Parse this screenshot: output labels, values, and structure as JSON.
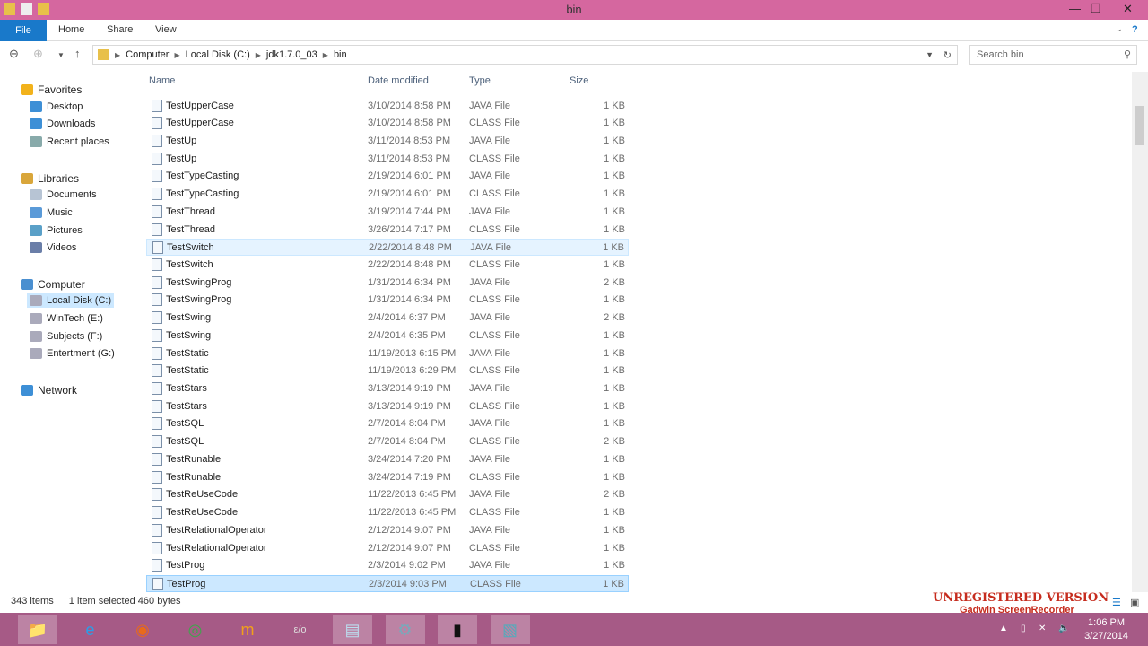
{
  "window": {
    "title": "bin"
  },
  "ribbon": {
    "file": "File",
    "tabs": [
      "Home",
      "Share",
      "View"
    ]
  },
  "breadcrumb": [
    "Computer",
    "Local Disk (C:)",
    "jdk1.7.0_03",
    "bin"
  ],
  "search": {
    "placeholder": "Search bin"
  },
  "sidebar": [
    {
      "label": "Favorites",
      "icon": "star-icon",
      "group": true
    },
    {
      "label": "Desktop",
      "icon": "desktop-icon"
    },
    {
      "label": "Downloads",
      "icon": "downloads-icon"
    },
    {
      "label": "Recent places",
      "icon": "recent-places-icon"
    },
    {
      "label": "Libraries",
      "icon": "libraries-icon",
      "group": true
    },
    {
      "label": "Documents",
      "icon": "documents-icon"
    },
    {
      "label": "Music",
      "icon": "music-icon"
    },
    {
      "label": "Pictures",
      "icon": "pictures-icon"
    },
    {
      "label": "Videos",
      "icon": "videos-icon"
    },
    {
      "label": "Computer",
      "icon": "computer-icon",
      "group": true
    },
    {
      "label": "Local Disk (C:)",
      "icon": "drive-icon",
      "selected": true
    },
    {
      "label": "WinTech (E:)",
      "icon": "drive-icon"
    },
    {
      "label": "Subjects (F:)",
      "icon": "drive-icon"
    },
    {
      "label": "Entertment (G:)",
      "icon": "drive-icon"
    },
    {
      "label": "Network",
      "icon": "network-icon",
      "group": true
    }
  ],
  "columns": [
    "Name",
    "Date modified",
    "Type",
    "Size"
  ],
  "files": [
    [
      "TestUpperCase",
      "3/10/2014 8:58 PM",
      "JAVA File",
      "1 KB"
    ],
    [
      "TestUpperCase",
      "3/10/2014 8:58 PM",
      "CLASS File",
      "1 KB"
    ],
    [
      "TestUp",
      "3/11/2014 8:53 PM",
      "JAVA File",
      "1 KB"
    ],
    [
      "TestUp",
      "3/11/2014 8:53 PM",
      "CLASS File",
      "1 KB"
    ],
    [
      "TestTypeCasting",
      "2/19/2014 6:01 PM",
      "JAVA File",
      "1 KB"
    ],
    [
      "TestTypeCasting",
      "2/19/2014 6:01 PM",
      "CLASS File",
      "1 KB"
    ],
    [
      "TestThread",
      "3/19/2014 7:44 PM",
      "JAVA File",
      "1 KB"
    ],
    [
      "TestThread",
      "3/26/2014 7:17 PM",
      "CLASS File",
      "1 KB"
    ],
    [
      "TestSwitch",
      "2/22/2014 8:48 PM",
      "JAVA File",
      "1 KB"
    ],
    [
      "TestSwitch",
      "2/22/2014 8:48 PM",
      "CLASS File",
      "1 KB"
    ],
    [
      "TestSwingProg",
      "1/31/2014 6:34 PM",
      "JAVA File",
      "2 KB"
    ],
    [
      "TestSwingProg",
      "1/31/2014 6:34 PM",
      "CLASS File",
      "1 KB"
    ],
    [
      "TestSwing",
      "2/4/2014 6:37 PM",
      "JAVA File",
      "2 KB"
    ],
    [
      "TestSwing",
      "2/4/2014 6:35 PM",
      "CLASS File",
      "1 KB"
    ],
    [
      "TestStatic",
      "11/19/2013 6:15 PM",
      "JAVA File",
      "1 KB"
    ],
    [
      "TestStatic",
      "11/19/2013 6:29 PM",
      "CLASS File",
      "1 KB"
    ],
    [
      "TestStars",
      "3/13/2014 9:19 PM",
      "JAVA File",
      "1 KB"
    ],
    [
      "TestStars",
      "3/13/2014 9:19 PM",
      "CLASS File",
      "1 KB"
    ],
    [
      "TestSQL",
      "2/7/2014 8:04 PM",
      "JAVA File",
      "1 KB"
    ],
    [
      "TestSQL",
      "2/7/2014 8:04 PM",
      "CLASS File",
      "2 KB"
    ],
    [
      "TestRunable",
      "3/24/2014 7:20 PM",
      "JAVA File",
      "1 KB"
    ],
    [
      "TestRunable",
      "3/24/2014 7:19 PM",
      "CLASS File",
      "1 KB"
    ],
    [
      "TestReUseCode",
      "11/22/2013 6:45 PM",
      "JAVA File",
      "2 KB"
    ],
    [
      "TestReUseCode",
      "11/22/2013 6:45 PM",
      "CLASS File",
      "1 KB"
    ],
    [
      "TestRelationalOperator",
      "2/12/2014 9:07 PM",
      "JAVA File",
      "1 KB"
    ],
    [
      "TestRelationalOperator",
      "2/12/2014 9:07 PM",
      "CLASS File",
      "1 KB"
    ],
    [
      "TestProg",
      "2/3/2014 9:02 PM",
      "JAVA File",
      "1 KB"
    ],
    [
      "TestProg",
      "2/3/2014 9:03 PM",
      "CLASS File",
      "1 KB"
    ]
  ],
  "hovered_index": 8,
  "selected_index": 27,
  "status": {
    "items": "343 items",
    "selection": "1 item selected  460 bytes"
  },
  "watermark": {
    "line1": "UNREGISTERED VERSION",
    "line2": "Gadwin ScreenRecorder"
  },
  "clock": {
    "time": "1:06 PM",
    "date": "3/27/2014"
  },
  "taskbar": [
    "file-explorer-icon",
    "internet-explorer-icon",
    "firefox-icon",
    "chrome-icon",
    "app-icon",
    "evo-icon",
    "notepad-icon",
    "control-panel-icon",
    "command-prompt-icon",
    "photo-viewer-icon"
  ],
  "colors": {
    "titlebar": "#d5679f",
    "taskbar": "#a65a86",
    "selection": "#cce8ff",
    "file_tab": "#1979ca"
  }
}
